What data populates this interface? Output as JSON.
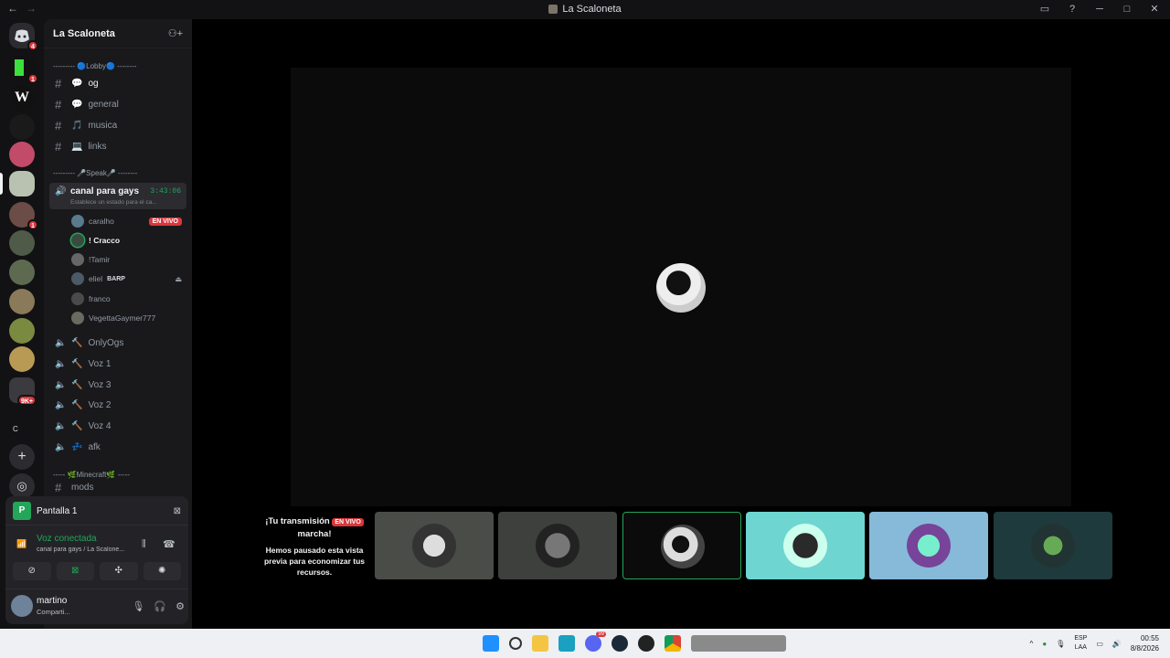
{
  "window": {
    "title": "La Scaloneta"
  },
  "rail": {
    "dm_badge": "4",
    "badges": [
      "1",
      "1",
      "9K+"
    ],
    "folder_label": "C"
  },
  "guild": {
    "name": "La Scaloneta"
  },
  "categories": {
    "lobby": "--------- 🔵Lobby🔵 --------",
    "speak": "--------- 🎤Speak🎤 --------",
    "minecraft": "----- 🌿Minecraft🌿 -----"
  },
  "text_channels": [
    {
      "label": "og"
    },
    {
      "label": "general"
    },
    {
      "label": "musica"
    },
    {
      "label": "links"
    }
  ],
  "active_voice": {
    "name": "canal para gays",
    "time": "3:43:06",
    "status": "Establece un estado para el ca..."
  },
  "members": [
    {
      "name": "caralho",
      "live": "EN VIVO"
    },
    {
      "name": "! Cracco"
    },
    {
      "name": "!Tamir"
    },
    {
      "name": "eliel",
      "tag": "BARP"
    },
    {
      "name": "franco"
    },
    {
      "name": "VegettaGaymer777"
    }
  ],
  "voice_channels": [
    {
      "label": "OnlyOgs"
    },
    {
      "label": "Voz 1"
    },
    {
      "label": "Voz 3"
    },
    {
      "label": "Voz 2"
    },
    {
      "label": "Voz 4"
    },
    {
      "label": "afk"
    }
  ],
  "last_channel": "mods",
  "panel": {
    "screen_label": "Pantalla 1",
    "screen_icon": "P",
    "voice_status": "Voz conectada",
    "voice_sub": "canal para gays / La Scalone...",
    "user_name": "martino",
    "user_status": "Comparti..."
  },
  "stream_notice": {
    "title_a": "¡Tu transmisión",
    "title_b": "marcha!",
    "live": "EN VIVO",
    "desc": "Hemos pausado esta vista previa para economizar tus recursos."
  },
  "taskbar": {
    "lang_top": "ESP",
    "lang_bottom": "LAA",
    "time": "00:55",
    "date": "8/8/2026",
    "discord_badge": "99"
  }
}
